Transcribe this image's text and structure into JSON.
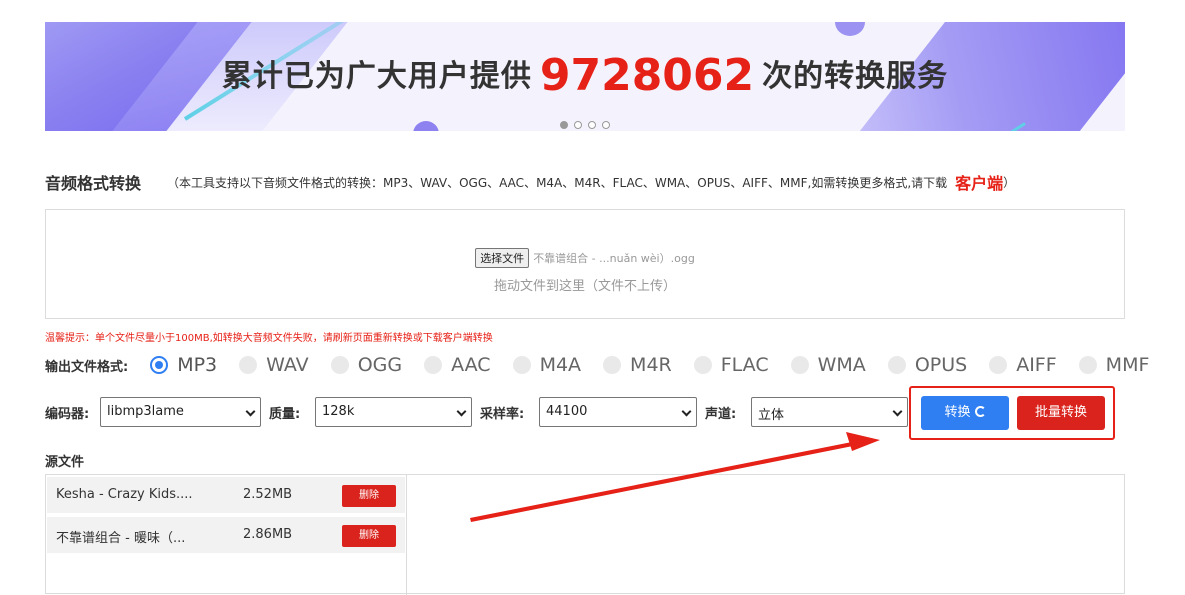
{
  "banner": {
    "prefix": "累计已为广大用户提供",
    "count": "9728062",
    "suffix": "次的转换服务"
  },
  "header": {
    "title": "音频格式转换",
    "description": "（本工具支持以下音频文件格式的转换：MP3、WAV、OGG、AAC、M4A、M4R、FLAC、WMA、OPUS、AIFF、MMF,如需转换更多格式,请下载",
    "client_link": "客户端",
    "close_paren": "）"
  },
  "upload": {
    "choose_button": "选择文件",
    "chosen_file": "不靠谱组合 - ...nuǎn wèi）.ogg",
    "drop_hint": "拖动文件到这里（文件不上传）"
  },
  "warning": "温馨提示：单个文件尽量小于100MB,如转换大音频文件失败，请刷新页面重新转换或下载客户端转换",
  "output_format": {
    "label": "输出文件格式:",
    "selected": "MP3",
    "options": [
      "MP3",
      "WAV",
      "OGG",
      "AAC",
      "M4A",
      "M4R",
      "FLAC",
      "WMA",
      "OPUS",
      "AIFF",
      "MMF"
    ]
  },
  "options": {
    "encoder_label": "编码器:",
    "encoder_value": "libmp3lame",
    "quality_label": "质量:",
    "quality_value": "128k",
    "samplerate_label": "采样率:",
    "samplerate_value": "44100",
    "channel_label": "声道:",
    "channel_value": "立体"
  },
  "actions": {
    "convert_label": "转换",
    "batch_label": "批量转换"
  },
  "source": {
    "title": "源文件",
    "delete_label": "删除",
    "files": [
      {
        "name": "Kesha - Crazy Kids....",
        "size": "2.52MB"
      },
      {
        "name": "不靠谱组合 - 暖味（...",
        "size": "2.86MB"
      }
    ]
  },
  "colors": {
    "accent_blue": "#2f7ff3",
    "accent_red": "#e62117"
  }
}
